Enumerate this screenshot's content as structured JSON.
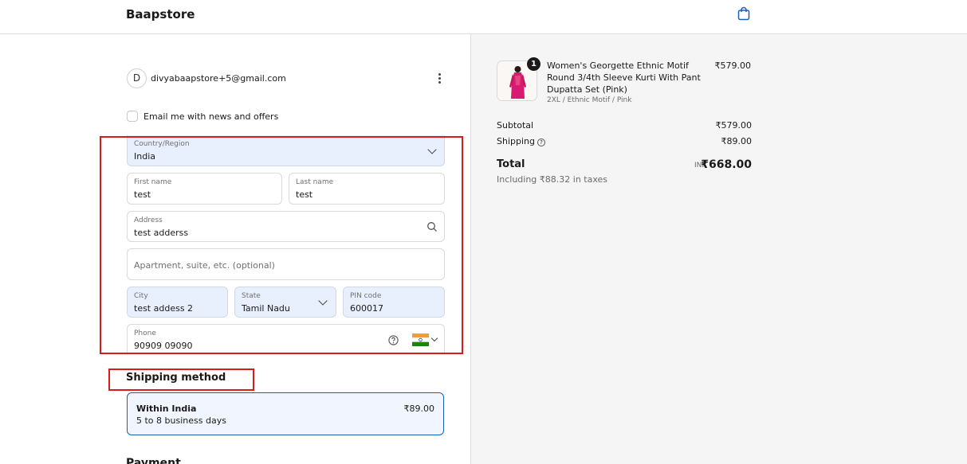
{
  "header": {
    "brand": "Baapstore",
    "cart_icon": "shopping-bag-icon"
  },
  "account": {
    "avatar_letter": "D",
    "email": "divyabaapstore+5@gmail.com",
    "menu_icon": "kebab-menu-icon"
  },
  "newsletter": {
    "label": "Email me with news and offers",
    "checked": false
  },
  "delivery_form": {
    "country": {
      "label": "Country/Region",
      "value": "India"
    },
    "first_name": {
      "label": "First name",
      "value": "test"
    },
    "last_name": {
      "label": "Last name",
      "value": "test"
    },
    "address": {
      "label": "Address",
      "value": "test adderss"
    },
    "apartment": {
      "placeholder": "Apartment, suite, etc. (optional)"
    },
    "city": {
      "label": "City",
      "value": "test addess 2"
    },
    "state": {
      "label": "State",
      "value": "Tamil Nadu"
    },
    "pin": {
      "label": "PIN code",
      "value": "600017"
    },
    "phone": {
      "label": "Phone",
      "value": "90909 09090"
    }
  },
  "shipping": {
    "title": "Shipping method",
    "option": {
      "name": "Within India",
      "days": "5 to 8 business days",
      "price": "₹89.00"
    }
  },
  "payment": {
    "title": "Payment"
  },
  "order_summary": {
    "item": {
      "quantity": "1",
      "title": "Women's Georgette Ethnic Motif Round 3/4th Sleeve Kurti With Pant Dupatta Set (Pink)",
      "variant": "2XL / Ethnic Motif / Pink",
      "price": "₹579.00"
    },
    "subtotal_label": "Subtotal",
    "subtotal_value": "₹579.00",
    "shipping_label": "Shipping",
    "shipping_value": "₹89.00",
    "total_label": "Total",
    "currency": "INR",
    "total_value": "₹668.00",
    "tax_note": "Including ₹88.32 in taxes"
  },
  "colors": {
    "accent": "#1b5fb4",
    "highlight_box": "#d91a1a",
    "autofill_bg": "#e8f0fe",
    "summary_bg": "#f5f5f5"
  }
}
